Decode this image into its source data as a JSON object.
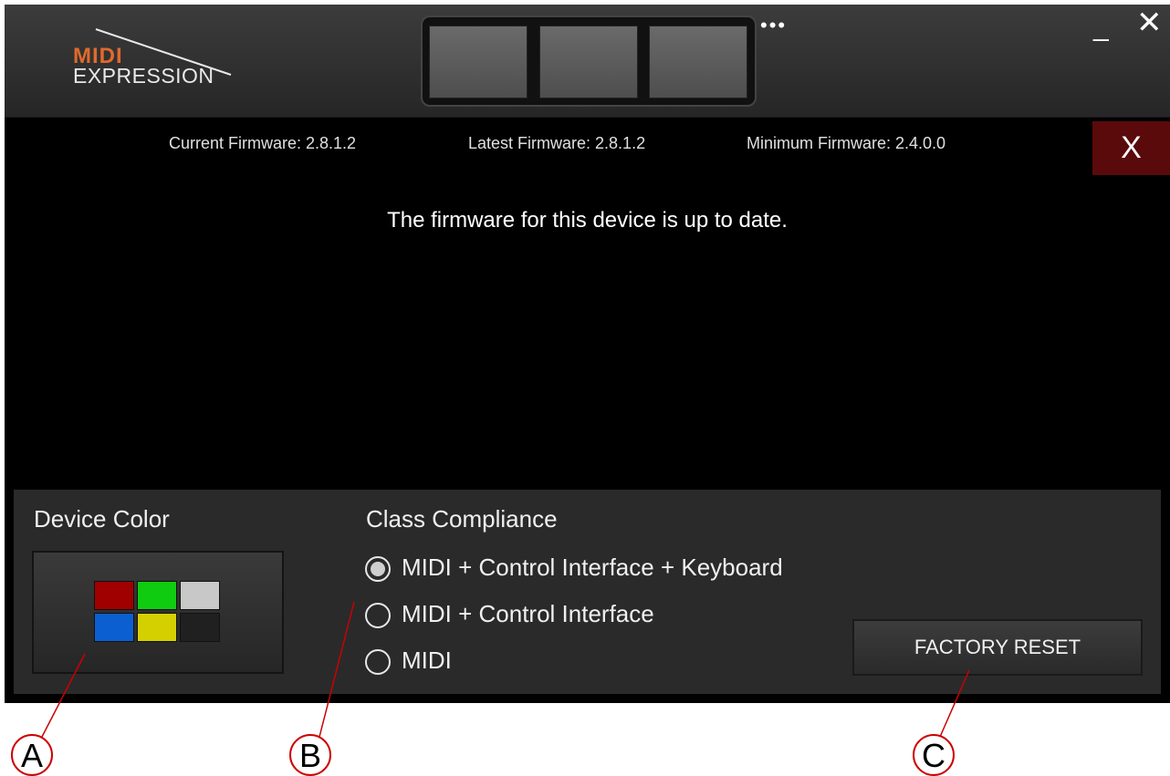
{
  "app": {
    "logo_top": "MIDI",
    "logo_bottom": "EXPRESSION"
  },
  "titlebar": {
    "more_label": "•••",
    "minimize_label": "_",
    "close_label": "✕"
  },
  "firmware": {
    "current": "Current Firmware:  2.8.1.2",
    "latest": "Latest Firmware:  2.8.1.2",
    "minimum": "Minimum Firmware:  2.4.0.0",
    "close_label": "X",
    "status": "The firmware for this device is up to date."
  },
  "device_color": {
    "label": "Device Color",
    "swatches": [
      "#a00000",
      "#10cc10",
      "#c8c8c8",
      "#0c5fd0",
      "#d4d000",
      "#202020"
    ]
  },
  "class_compliance": {
    "label": "Class Compliance",
    "options": [
      {
        "label": "MIDI + Control Interface + Keyboard",
        "selected": true
      },
      {
        "label": "MIDI + Control Interface",
        "selected": false
      },
      {
        "label": "MIDI",
        "selected": false
      }
    ]
  },
  "factory_reset": {
    "label": "FACTORY RESET"
  },
  "callouts": [
    "A",
    "B",
    "C"
  ]
}
